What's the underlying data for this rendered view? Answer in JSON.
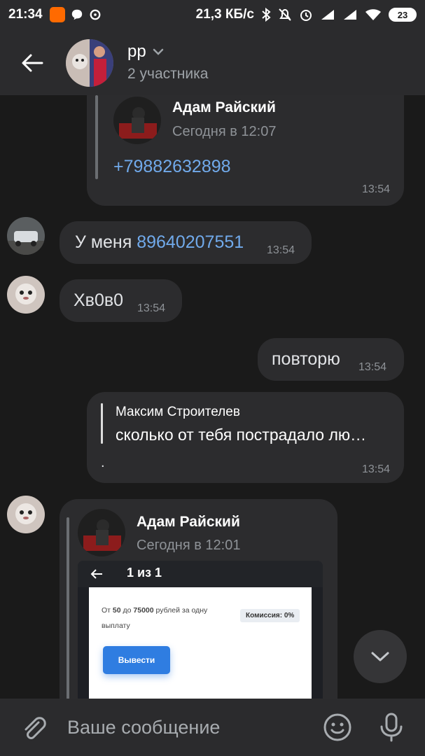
{
  "status_bar": {
    "time": "21:34",
    "speed": "21,3 КБ/с",
    "battery": "23"
  },
  "header": {
    "title": "рр",
    "subtitle": "2 участника"
  },
  "messages": [
    {
      "forward_author": "Адам Райский",
      "forward_date": "Сегодня в 12:07",
      "forward_link": "+79882632898",
      "time": "13:54"
    },
    {
      "text_prefix": "У меня",
      "link": "89640207551",
      "time": "13:54"
    },
    {
      "text": "Хв0в0",
      "time": "13:54"
    },
    {
      "text": "повторю",
      "time": "13:54"
    },
    {
      "reply_author": "Максим Строителев",
      "reply_text": "сколько от тебя пострадало лю…",
      "text": ".",
      "time": "13:54"
    },
    {
      "forward_author": "Адам Райский",
      "forward_date": "Сегодня в 12:01",
      "screenshot": {
        "counter": "1 из 1",
        "range_text_1": "От ",
        "range_min": "50",
        "range_mid": " до ",
        "range_max": "75000",
        "range_text_2": " рублей за одну",
        "range_text_3": "выплату",
        "fee_badge": "Комиссия: 0%",
        "withdraw_button": "Вывести"
      }
    }
  ],
  "composer": {
    "placeholder": "Ваше сообщение"
  },
  "colors": {
    "accent": "#71aaeb",
    "bubble": "#2c2c2e",
    "background": "#1a1a1a",
    "bar": "#2b2b2d"
  }
}
